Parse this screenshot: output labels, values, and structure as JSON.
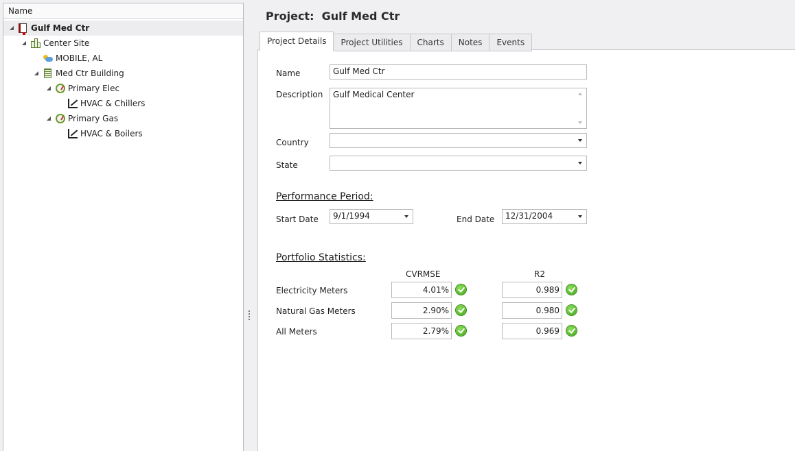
{
  "tree": {
    "header": "Name",
    "nodes": [
      {
        "label": "Gulf Med Ctr",
        "icon": "project-book-icon"
      },
      {
        "label": "Center Site",
        "icon": "site-buildings-icon"
      },
      {
        "label": "MOBILE, AL",
        "icon": "weather-icon"
      },
      {
        "label": "Med Ctr Building",
        "icon": "building-icon"
      },
      {
        "label": "Primary Elec",
        "icon": "meter-icon"
      },
      {
        "label": "HVAC & Chillers",
        "icon": "model-chart-icon"
      },
      {
        "label": "Primary Gas",
        "icon": "meter-icon"
      },
      {
        "label": "HVAC & Boilers",
        "icon": "model-chart-icon"
      }
    ]
  },
  "header": {
    "project_label": "Project:",
    "project_name": "Gulf Med Ctr"
  },
  "tabs": [
    {
      "label": "Project Details",
      "active": true
    },
    {
      "label": "Project Utilities",
      "active": false
    },
    {
      "label": "Charts",
      "active": false
    },
    {
      "label": "Notes",
      "active": false
    },
    {
      "label": "Events",
      "active": false
    }
  ],
  "form": {
    "name_label": "Name",
    "name_value": "Gulf Med Ctr",
    "description_label": "Description",
    "description_value": "Gulf Medical Center",
    "country_label": "Country",
    "country_value": "",
    "state_label": "State",
    "state_value": ""
  },
  "performance": {
    "title": "Performance Period:",
    "start_label": "Start Date",
    "start_value": "9/1/1994",
    "end_label": "End Date",
    "end_value": "12/31/2004"
  },
  "statistics": {
    "title": "Portfolio Statistics:",
    "col_cvrmse": "CVRMSE",
    "col_r2": "R2",
    "rows": [
      {
        "label": "Electricity Meters",
        "cvrmse": "4.01%",
        "r2": "0.989"
      },
      {
        "label": "Natural Gas Meters",
        "cvrmse": "2.90%",
        "r2": "0.980"
      },
      {
        "label": "All Meters",
        "cvrmse": "2.79%",
        "r2": "0.969"
      }
    ]
  },
  "colors": {
    "status_ok": "#3fa21a",
    "selected_row": "#ededef"
  }
}
